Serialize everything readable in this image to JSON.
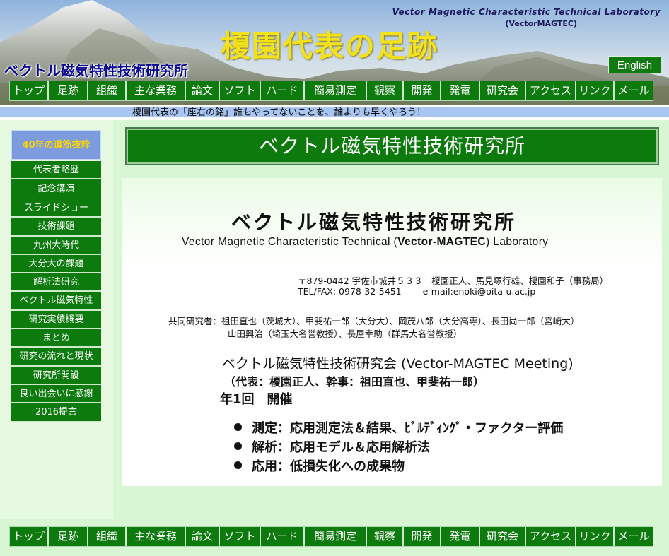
{
  "header": {
    "lab_name_en": "Vector Magnetic Characteristic Technical Laboratory",
    "lab_abbrev": "(VectorMAGTEC)",
    "main_title": "榎園代表の足跡",
    "subtitle": "ベクトル磁気特性技術研究所",
    "english_button": "English"
  },
  "nav": {
    "items": [
      "トップ",
      "足跡",
      "組織",
      "主な業務",
      "論文",
      "ソフト",
      "ハード",
      "簡易測定",
      "観察",
      "開発",
      "発電",
      "研究会",
      "アクセス",
      "リンク",
      "メール"
    ]
  },
  "marquee": "榎園代表の「座右の銘」誰もやってないことを、誰よりも早くやろう！",
  "sidebar": {
    "top": "40年の道筋抜粋",
    "items": [
      "代表者略歴",
      "記念講演\nスライドショー",
      "技術課題",
      "九州大時代",
      "大分大の課題",
      "解析法研究",
      "ベクトル磁気特性",
      "研究実績概要",
      "まとめ",
      "研究の流れと現状",
      "研究所開設",
      "良い出会いに感謝",
      "2016提言"
    ]
  },
  "main": {
    "banner": "ベクトル磁気特性技術研究所",
    "title_ja": "ベクトル磁気特性技術研究所",
    "title_en_pre": "Vector Magnetic Characteristic Technical (",
    "title_en_bold": "Vector-MAGTEC",
    "title_en_post": ") Laboratory",
    "address": "〒879-0442 宇佐市城井５３３　榎園正人、馬見塚行雄、榎園和子（事務局）",
    "tel": "TEL/FAX: 0978-32-5451",
    "email": "e-mail:enoki@oita-u.ac.jp",
    "co_researchers_1": "共同研究者：祖田直也（茨城大）、甲斐祐一郎（大分大）、岡茂八郎（大分高専）、長田尚一郎（宮崎大）",
    "co_researchers_2": "山田興治（埼玉大名誉教授）、長屋幸助（群馬大名誉教授）",
    "meeting": "ベクトル磁気特性技術研究会 (Vector-MAGTEC  Meeting)",
    "meeting_sub": "（代表：榎園正人、幹事：祖田直也、甲斐祐一郎）",
    "meeting_freq": "年1回　開催",
    "bullets": [
      "測定：応用測定法＆結果、ﾋﾞﾙﾃﾞｨﾝｸﾞ・ファクター評価",
      "解析：応用モデル＆応用解析法",
      "応用：低損失化への成果物"
    ]
  },
  "colors": {
    "nav_green": "#0c7a0c",
    "title_yellow": "#f3e21a",
    "sidebar_top_blue": "#7d9ce0",
    "page_bg": "#d9f6d4"
  }
}
